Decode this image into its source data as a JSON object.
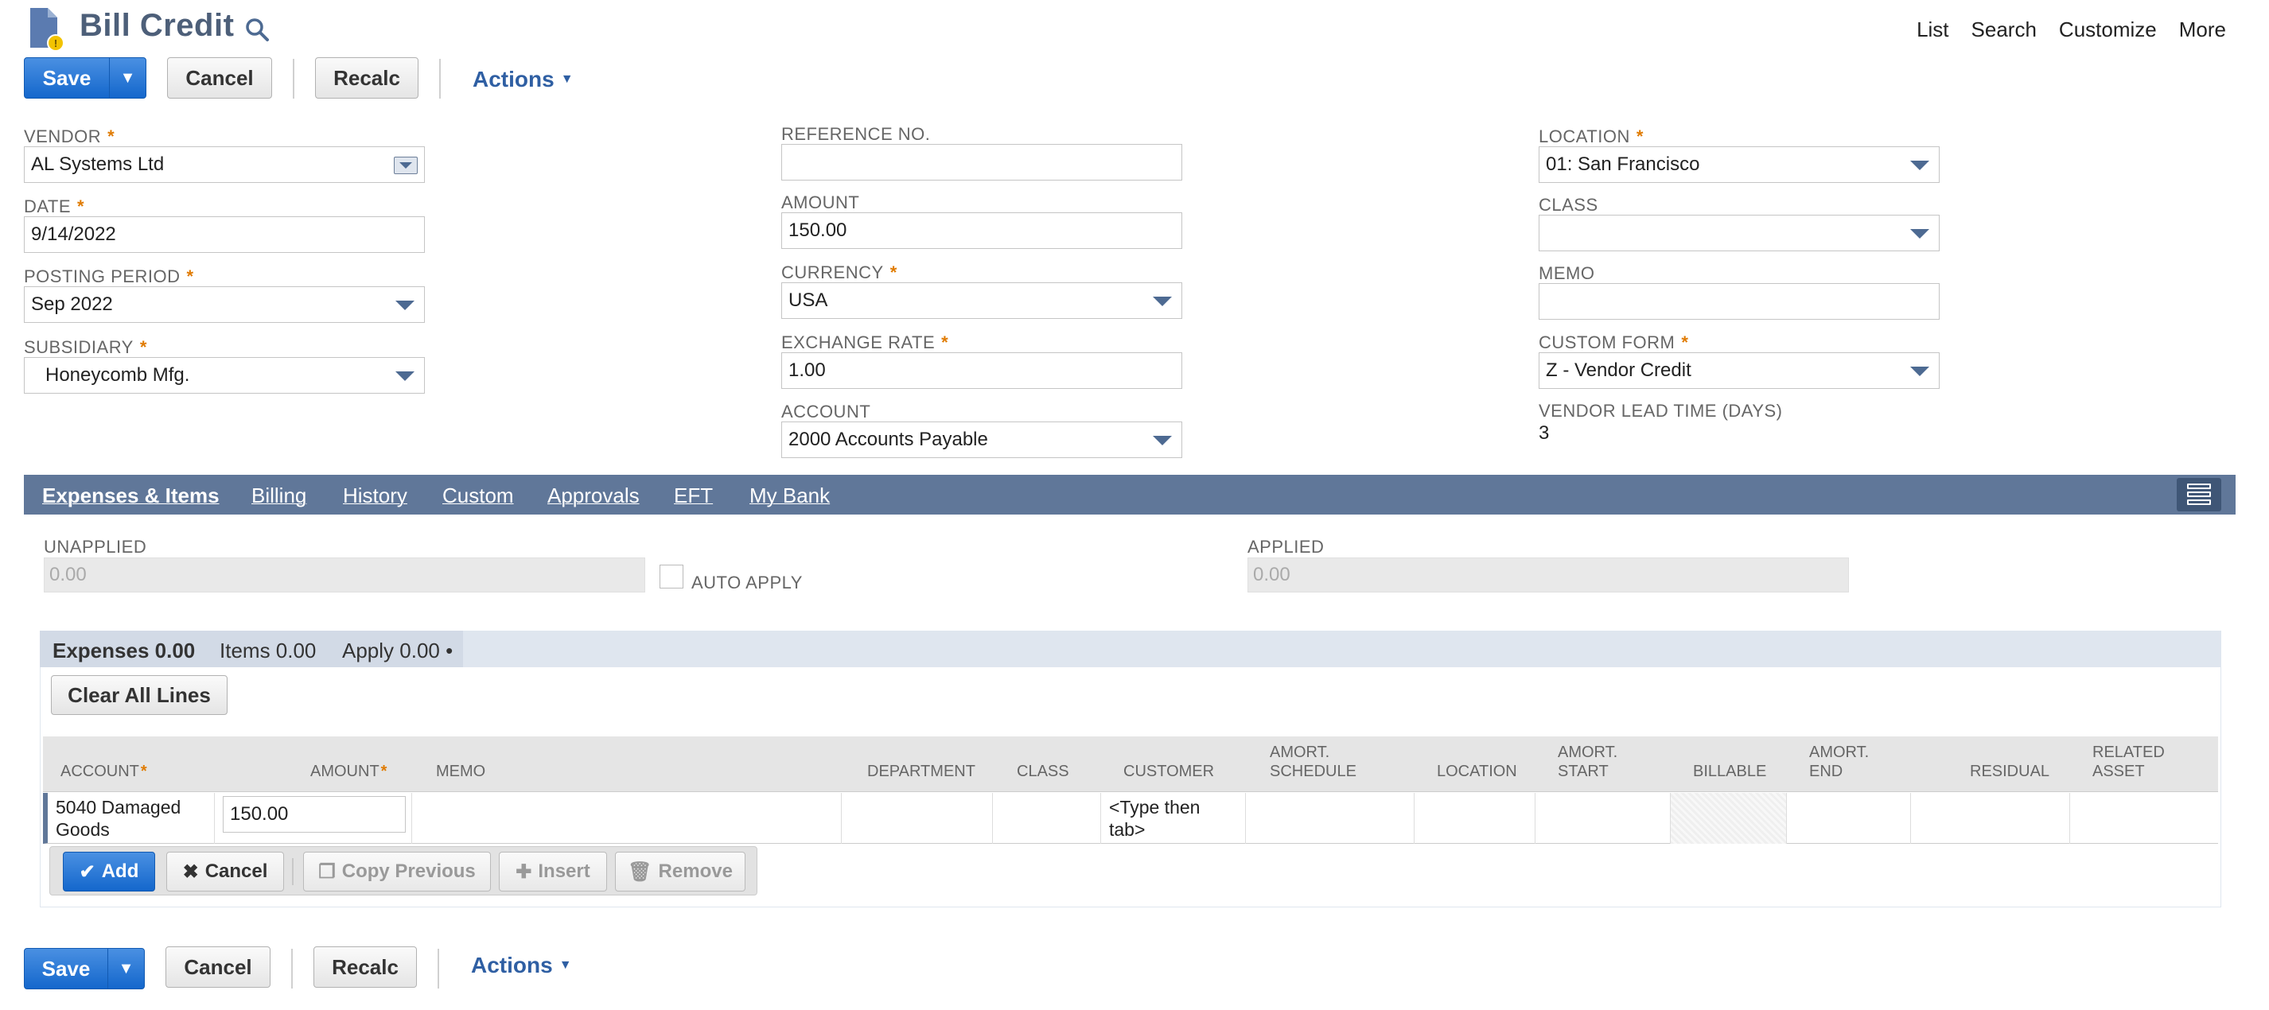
{
  "header": {
    "title": "Bill Credit",
    "links": [
      "List",
      "Search",
      "Customize",
      "More"
    ]
  },
  "toolbar": {
    "save_label": "Save",
    "cancel_label": "Cancel",
    "recalc_label": "Recalc",
    "actions_label": "Actions"
  },
  "fields": {
    "vendor": {
      "label": "VENDOR",
      "value": "AL Systems Ltd"
    },
    "date": {
      "label": "DATE",
      "value": "9/14/2022"
    },
    "posting_period": {
      "label": "POSTING PERIOD",
      "value": "Sep 2022"
    },
    "subsidiary": {
      "label": "SUBSIDIARY",
      "value": "Honeycomb Mfg."
    },
    "reference_no": {
      "label": "REFERENCE NO.",
      "value": ""
    },
    "amount": {
      "label": "AMOUNT",
      "value": "150.00"
    },
    "currency": {
      "label": "CURRENCY",
      "value": "USA"
    },
    "exchange_rate": {
      "label": "EXCHANGE RATE",
      "value": "1.00"
    },
    "account": {
      "label": "ACCOUNT",
      "value": "2000 Accounts Payable"
    },
    "location": {
      "label": "LOCATION",
      "value": "01: San Francisco"
    },
    "class": {
      "label": "CLASS",
      "value": ""
    },
    "memo": {
      "label": "MEMO",
      "value": ""
    },
    "custom_form": {
      "label": "CUSTOM FORM",
      "value": "Z - Vendor Credit"
    },
    "vendor_lead_time": {
      "label": "VENDOR LEAD TIME (DAYS)",
      "value": "3"
    }
  },
  "required_mark": "*",
  "tabs": {
    "expenses_items": "Expenses & Items",
    "billing": "Billing",
    "history": "History",
    "custom": "Custom",
    "approvals": "Approvals",
    "eft": "EFT",
    "my_bank": "My Bank"
  },
  "apply": {
    "unapplied_label": "UNAPPLIED",
    "unapplied_value": "0.00",
    "auto_apply_label": "AUTO APPLY",
    "applied_label": "APPLIED",
    "applied_value": "0.00"
  },
  "subtabs": {
    "expenses": "Expenses 0.00",
    "items": "Items 0.00",
    "apply": "Apply 0.00 •"
  },
  "clear_all_lines_label": "Clear All Lines",
  "grid": {
    "columns": {
      "account": "ACCOUNT",
      "amount": "AMOUNT",
      "memo": "MEMO",
      "department": "DEPARTMENT",
      "class": "CLASS",
      "customer": "CUSTOMER",
      "amort_schedule_1": "AMORT.",
      "amort_schedule_2": "SCHEDULE",
      "location": "LOCATION",
      "amort_start_1": "AMORT.",
      "amort_start_2": "START",
      "billable": "BILLABLE",
      "amort_end_1": "AMORT.",
      "amort_end_2": "END",
      "residual": "RESIDUAL",
      "related_asset_1": "RELATED",
      "related_asset_2": "ASSET"
    },
    "row": {
      "account_1": "5040 Damaged",
      "account_2": "Goods",
      "amount": "150.00",
      "customer_1": "<Type then",
      "customer_2": "tab>"
    },
    "row_actions": {
      "add": "Add",
      "cancel": "Cancel",
      "copy_previous": "Copy Previous",
      "insert": "Insert",
      "remove": "Remove"
    }
  },
  "colors": {
    "accent_blue": "#1467cc",
    "tab_bar": "#607799",
    "title": "#4d5f79",
    "required": "#e07b00"
  }
}
